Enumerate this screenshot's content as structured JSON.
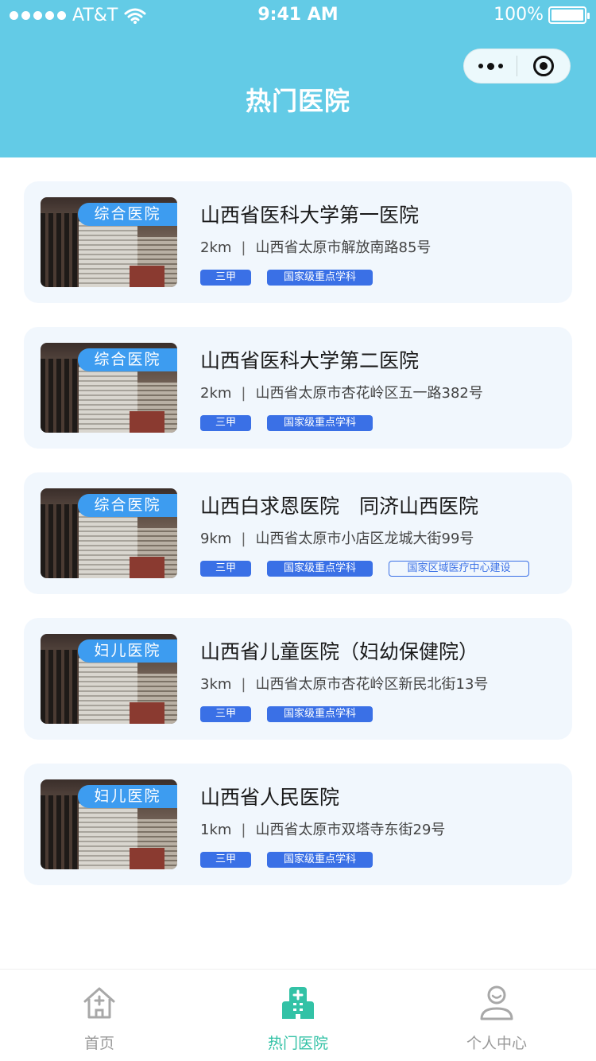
{
  "status_bar": {
    "carrier": "AT&T",
    "time": "9:41 AM",
    "battery": "100%",
    "signal_dots": 5
  },
  "capsule": {
    "more_icon": "more-dots-icon",
    "close_icon": "target-circle-icon"
  },
  "header": {
    "title": "热门医院"
  },
  "hospitals": [
    {
      "category": "综合医院",
      "name": "山西省医科大学第一医院",
      "distance": "2km",
      "address": "山西省太原市解放南路85号",
      "tags": [
        "三甲",
        "国家级重点学科"
      ],
      "outline_tag": ""
    },
    {
      "category": "综合医院",
      "name": "山西省医科大学第二医院",
      "distance": "2km",
      "address": "山西省太原市杏花岭区五一路382号",
      "tags": [
        "三甲",
        "国家级重点学科"
      ],
      "outline_tag": ""
    },
    {
      "category": "综合医院",
      "name": "山西白求恩医院　同济山西医院",
      "distance": "9km",
      "address": "山西省太原市小店区龙城大街99号",
      "tags": [
        "三甲",
        "国家级重点学科"
      ],
      "outline_tag": "国家区域医疗中心建设"
    },
    {
      "category": "妇儿医院",
      "name": "山西省儿童医院（妇幼保健院）",
      "distance": "3km",
      "address": "山西省太原市杏花岭区新民北街13号",
      "tags": [
        "三甲",
        "国家级重点学科"
      ],
      "outline_tag": ""
    },
    {
      "category": "妇儿医院",
      "name": "山西省人民医院",
      "distance": "1km",
      "address": "山西省太原市双塔寺东街29号",
      "tags": [
        "三甲",
        "国家级重点学科"
      ],
      "outline_tag": ""
    }
  ],
  "separator": "|",
  "tabbar": {
    "items": [
      {
        "label": "首页",
        "icon": "home-icon",
        "active": false
      },
      {
        "label": "热门医院",
        "icon": "hospital-icon",
        "active": true
      },
      {
        "label": "个人中心",
        "icon": "user-icon",
        "active": false
      }
    ]
  },
  "colors": {
    "header_bg": "#63cbe6",
    "card_bg": "#f1f7fd",
    "badge_blue": "#3a70e6",
    "tab_active": "#33c2a6",
    "tab_inactive": "#999999"
  }
}
